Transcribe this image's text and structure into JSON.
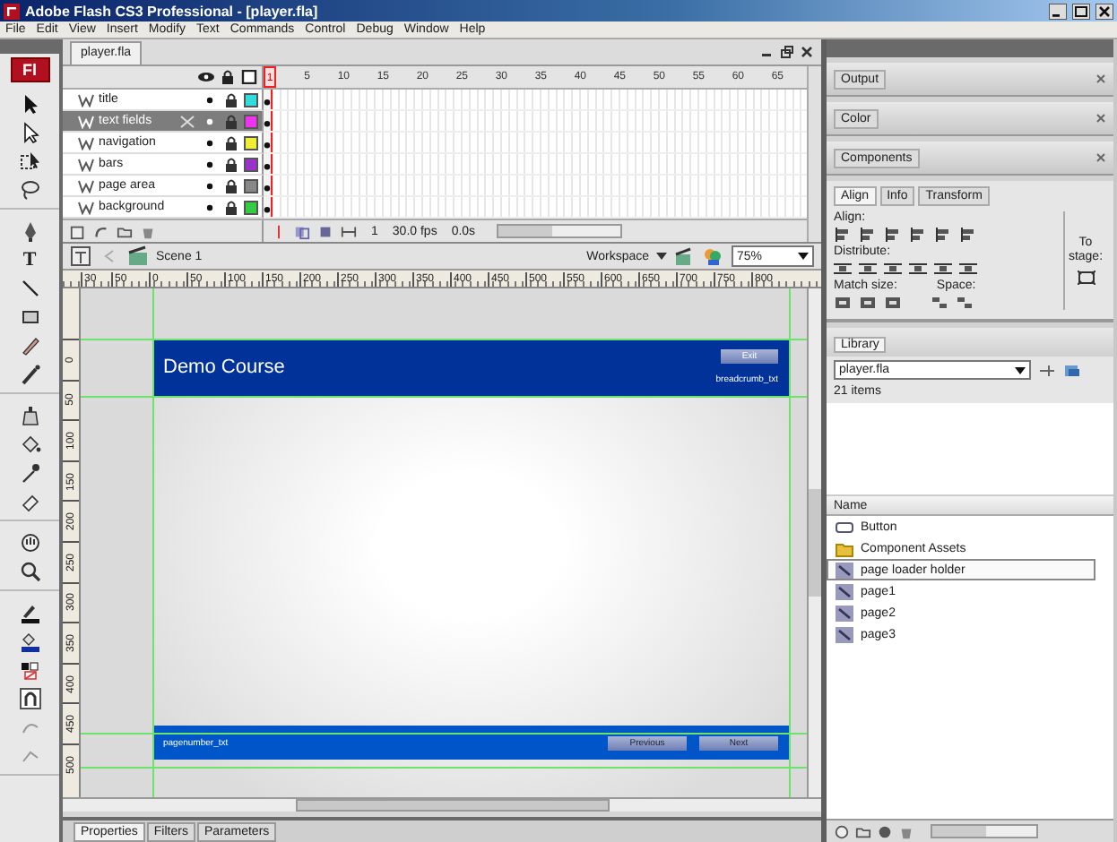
{
  "window": {
    "title": "Adobe Flash CS3 Professional - [player.fla]"
  },
  "menu": [
    "File",
    "Edit",
    "View",
    "Insert",
    "Modify",
    "Text",
    "Commands",
    "Control",
    "Debug",
    "Window",
    "Help"
  ],
  "toolbox": {
    "logo": "Fl",
    "text_tool": "T"
  },
  "document_tab": {
    "label": "player.fla"
  },
  "timeline": {
    "frame_numbers": [
      "1",
      "5",
      "10",
      "15",
      "20",
      "25",
      "30",
      "35",
      "40",
      "45",
      "50",
      "55",
      "60",
      "65"
    ],
    "layers": [
      {
        "name": "title",
        "selected": false,
        "color": "#33dddd"
      },
      {
        "name": "text fields",
        "selected": true,
        "color": "#ee33ee"
      },
      {
        "name": "navigation",
        "selected": false,
        "color": "#eeee33"
      },
      {
        "name": "bars",
        "selected": false,
        "color": "#9933cc"
      },
      {
        "name": "page area",
        "selected": false,
        "color": "#888888"
      },
      {
        "name": "background",
        "selected": false,
        "color": "#33cc44"
      }
    ],
    "current_frame": "1",
    "frame_rate": "30.0 fps",
    "elapsed": "0.0s"
  },
  "edit_bar": {
    "scene": "Scene 1",
    "workspace": "Workspace",
    "zoom": "75%"
  },
  "ruler": {
    "horizontal_marks": [
      "30",
      "50",
      "0",
      "50",
      "100",
      "150",
      "200",
      "250",
      "300",
      "350",
      "400",
      "450",
      "500",
      "550",
      "600",
      "650",
      "700",
      "750",
      "800"
    ],
    "vertical_marks": [
      "0",
      "50",
      "100",
      "150",
      "200",
      "250",
      "300",
      "350",
      "400",
      "450",
      "500"
    ]
  },
  "stage": {
    "title": "Demo Course",
    "exit_button": "Exit",
    "breadcrumb": "breadcrumb_txt",
    "page_number": "pagenumber_txt",
    "buttons": [
      "Previous",
      "Next"
    ]
  },
  "properties_tabs": [
    {
      "label": "Properties",
      "selected": true
    },
    {
      "label": "Filters",
      "selected": false
    },
    {
      "label": "Parameters",
      "selected": false
    }
  ],
  "panels": [
    {
      "label": "Output"
    },
    {
      "label": "Color"
    },
    {
      "label": "Components"
    }
  ],
  "align_panel": {
    "tabs": [
      {
        "label": "Align",
        "selected": true
      },
      {
        "label": "Info",
        "selected": false
      },
      {
        "label": "Transform",
        "selected": false
      }
    ],
    "align_label": "Align:",
    "distribute_label": "Distribute:",
    "match_size_label": "Match size:",
    "space_label": "Space:",
    "to_stage_label": "To stage:"
  },
  "library": {
    "tab": "Library",
    "document": "player.fla",
    "count": "21 items",
    "column": "Name",
    "items": [
      {
        "name": "Button",
        "kind": "button",
        "selected": false
      },
      {
        "name": "Component Assets",
        "kind": "folder",
        "selected": false
      },
      {
        "name": "page loader holder",
        "kind": "movieclip",
        "selected": true
      },
      {
        "name": "page1",
        "kind": "movieclip",
        "selected": false
      },
      {
        "name": "page2",
        "kind": "movieclip",
        "selected": false
      },
      {
        "name": "page3",
        "kind": "movieclip",
        "selected": false
      }
    ]
  }
}
